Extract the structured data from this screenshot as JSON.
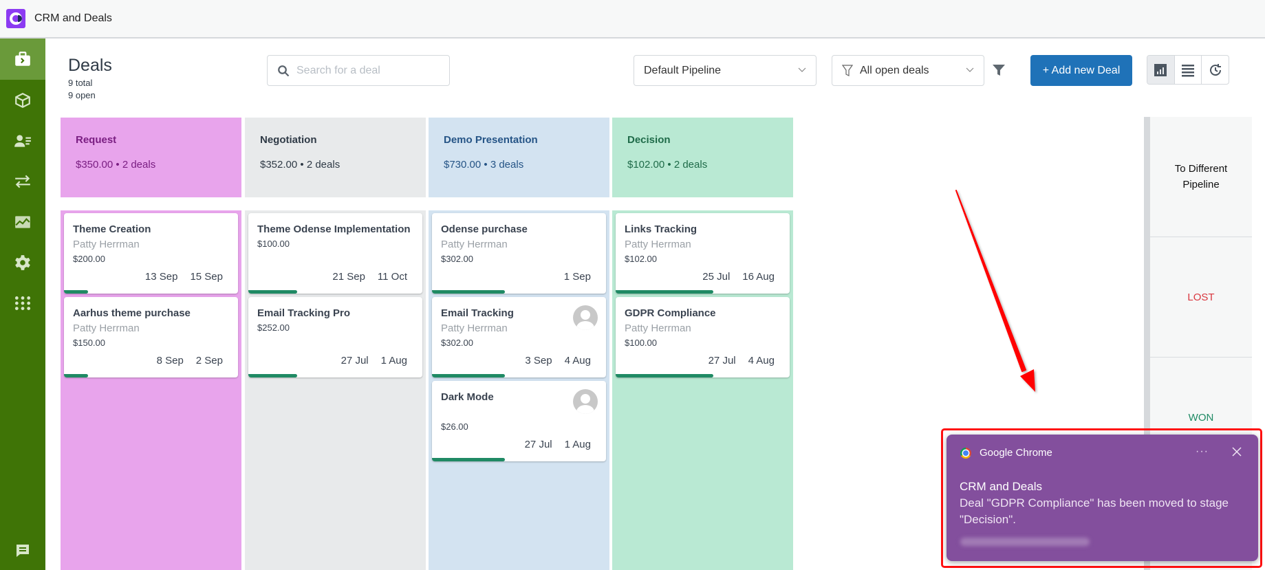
{
  "app": {
    "title": "CRM and Deals"
  },
  "sidebar": {
    "items": [
      {
        "name": "deals",
        "icon": "briefcase-icon",
        "active": true
      },
      {
        "name": "products",
        "icon": "box-icon",
        "active": false
      },
      {
        "name": "contacts",
        "icon": "contacts-icon",
        "active": false
      },
      {
        "name": "transfers",
        "icon": "arrows-exchange-icon",
        "active": false
      },
      {
        "name": "reports",
        "icon": "chart-image-icon",
        "active": false
      },
      {
        "name": "settings",
        "icon": "gear-icon",
        "active": false
      },
      {
        "name": "apps",
        "icon": "apps-grid-icon",
        "active": false
      }
    ],
    "bottom": {
      "icon": "chat-icon"
    }
  },
  "header": {
    "title": "Deals",
    "total": "9 total",
    "open": "9 open",
    "search_placeholder": "Search for a deal",
    "search_value": "",
    "pipeline_select": "Default Pipeline",
    "deals_filter": "All open deals",
    "add_button": "+ Add new Deal",
    "views": [
      {
        "name": "kanban",
        "icon": "bar-chart-icon",
        "active": true
      },
      {
        "name": "list",
        "icon": "list-icon",
        "active": false
      },
      {
        "name": "history",
        "icon": "history-icon",
        "active": false
      }
    ]
  },
  "columns": [
    {
      "name": "Request",
      "amount": "$350.00",
      "deals": "2 deals",
      "color": "#e8a4ec",
      "cards": [
        {
          "title": "Theme Creation",
          "person": "Patty Herrman",
          "value": "$200.00",
          "date1": "13 Sep",
          "date2": "15 Sep",
          "progress": 0.2,
          "avatar": false
        },
        {
          "title": "Aarhus theme purchase",
          "person": "Patty Herrman",
          "value": "$150.00",
          "date1": "8 Sep",
          "date2": "2 Sep",
          "progress": 0.2,
          "avatar": false
        }
      ]
    },
    {
      "name": "Negotiation",
      "amount": "$352.00",
      "deals": "2 deals",
      "color": "#e8eaeb",
      "cards": [
        {
          "title": "Theme Odense Implementation",
          "person": "",
          "value": "$100.00",
          "date1": "21 Sep",
          "date2": "11 Oct",
          "progress": 0.4,
          "avatar": false
        },
        {
          "title": "Email Tracking Pro",
          "person": "",
          "value": "$252.00",
          "date1": "27 Jul",
          "date2": "1 Aug",
          "progress": 0.4,
          "avatar": false
        }
      ]
    },
    {
      "name": "Demo Presentation",
      "amount": "$730.00",
      "deals": "3 deals",
      "color": "#d3e3f1",
      "cards": [
        {
          "title": "Odense purchase",
          "person": "Patty Herrman",
          "value": "$302.00",
          "date1": "",
          "date2": "1 Sep",
          "progress": 0.6,
          "avatar": false
        },
        {
          "title": "Email Tracking",
          "person": "Patty Herrman",
          "value": "$302.00",
          "date1": "3 Sep",
          "date2": "4 Aug",
          "progress": 0.6,
          "avatar": true
        },
        {
          "title": "Dark Mode",
          "person": "",
          "value": "$26.00",
          "date1": "27 Jul",
          "date2": "1 Aug",
          "progress": 0.6,
          "avatar": true
        }
      ]
    },
    {
      "name": "Decision",
      "amount": "$102.00",
      "deals": "2 deals",
      "color": "#b9e9d3",
      "cards": [
        {
          "title": "Links Tracking",
          "person": "Patty Herrman",
          "value": "$102.00",
          "date1": "25 Jul",
          "date2": "16 Aug",
          "progress": 0.8,
          "avatar": false
        },
        {
          "title": "GDPR Compliance",
          "person": "Patty Herrman",
          "value": "$100.00",
          "date1": "27 Jul",
          "date2": "4 Aug",
          "progress": 0.8,
          "avatar": false
        }
      ]
    }
  ],
  "drop_zones": {
    "pipeline": "To Different Pipeline",
    "lost": "LOST",
    "won": "WON"
  },
  "notification": {
    "source": "Google Chrome",
    "more": "···",
    "title": "CRM and Deals",
    "body": "Deal \"GDPR Compliance\" has been moved to stage \"Decision\"."
  }
}
